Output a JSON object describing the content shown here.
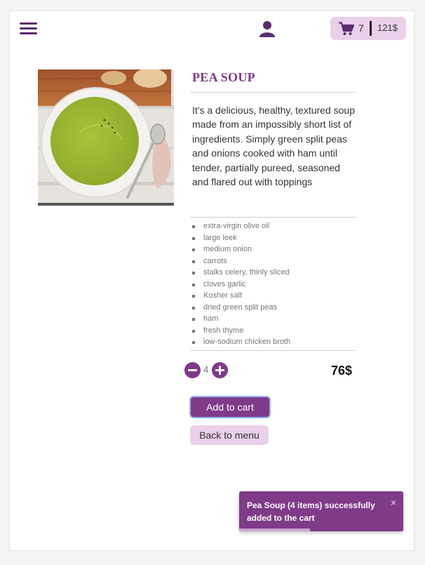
{
  "header": {
    "menu_icon": "hamburger-menu-icon",
    "user_icon": "user-icon",
    "cart": {
      "icon": "shopping-cart-icon",
      "count": "7",
      "total": "121$"
    }
  },
  "product": {
    "title": "PEA SOUP",
    "image_alt": "bowl of green pea soup",
    "description": "It's a delicious, healthy, textured soup made from an impossibly short list of ingredients. Simply green split peas and onions cooked with ham until tender, partially pureed, seasoned and flared out with toppings",
    "ingredients": [
      "extra-virgin olive oil",
      "large leek",
      "medium onion",
      "carrots",
      "stalks celery, thinly sliced",
      "cloves garlic",
      "Kosher salt",
      "dried green split peas",
      "ham",
      "fresh thyme",
      "low-sodium chicken broth"
    ],
    "quantity": "4",
    "price": "76$"
  },
  "actions": {
    "add_to_cart": "Add to cart",
    "back_to_menu": "Back to menu"
  },
  "toast": {
    "message": "Pea Soup (4 items) successfully added to the cart",
    "close_symbol": "×",
    "progress_fraction": 0.43
  },
  "colors": {
    "accent": "#7f3a88",
    "accent_light": "#ead0ea",
    "header_icon": "#5b2c6f",
    "focus_ring": "#8fb7f0"
  }
}
